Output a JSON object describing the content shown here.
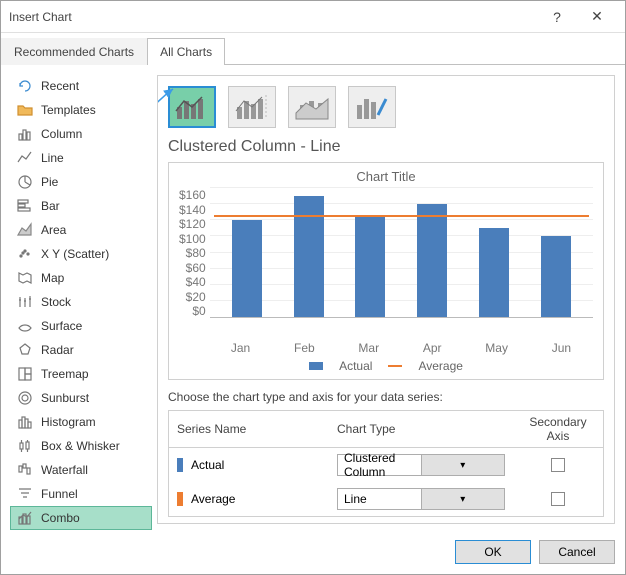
{
  "dialog": {
    "title": "Insert Chart",
    "help": "?",
    "close": "✕"
  },
  "tabs": {
    "recommended": "Recommended Charts",
    "all": "All Charts"
  },
  "sidebar": {
    "items": [
      {
        "label": "Recent"
      },
      {
        "label": "Templates"
      },
      {
        "label": "Column"
      },
      {
        "label": "Line"
      },
      {
        "label": "Pie"
      },
      {
        "label": "Bar"
      },
      {
        "label": "Area"
      },
      {
        "label": "X Y (Scatter)"
      },
      {
        "label": "Map"
      },
      {
        "label": "Stock"
      },
      {
        "label": "Surface"
      },
      {
        "label": "Radar"
      },
      {
        "label": "Treemap"
      },
      {
        "label": "Sunburst"
      },
      {
        "label": "Histogram"
      },
      {
        "label": "Box & Whisker"
      },
      {
        "label": "Waterfall"
      },
      {
        "label": "Funnel"
      },
      {
        "label": "Combo"
      }
    ]
  },
  "subtype_name": "Clustered Column - Line",
  "chart_data": {
    "type": "combo",
    "title": "Chart Title",
    "categories": [
      "Jan",
      "Feb",
      "Mar",
      "Apr",
      "May",
      "Jun"
    ],
    "series": [
      {
        "name": "Actual",
        "type": "bar",
        "color": "#4a7ebb",
        "values": [
          120,
          150,
          125,
          140,
          110,
          100
        ]
      },
      {
        "name": "Average",
        "type": "line",
        "color": "#ed7d31",
        "values": [
          124,
          124,
          124,
          124,
          124,
          124
        ]
      }
    ],
    "ylim": [
      0,
      160
    ],
    "yticks": [
      "$160",
      "$140",
      "$120",
      "$100",
      "$80",
      "$60",
      "$40",
      "$20",
      "$0"
    ],
    "legend": {
      "actual": "Actual",
      "average": "Average"
    }
  },
  "series_config": {
    "prompt": "Choose the chart type and axis for your data series:",
    "headers": {
      "name": "Series Name",
      "type": "Chart Type",
      "axis": "Secondary Axis"
    },
    "rows": [
      {
        "name": "Actual",
        "type": "Clustered Column",
        "color": "#4a7ebb"
      },
      {
        "name": "Average",
        "type": "Line",
        "color": "#ed7d31"
      }
    ]
  },
  "footer": {
    "ok": "OK",
    "cancel": "Cancel"
  }
}
